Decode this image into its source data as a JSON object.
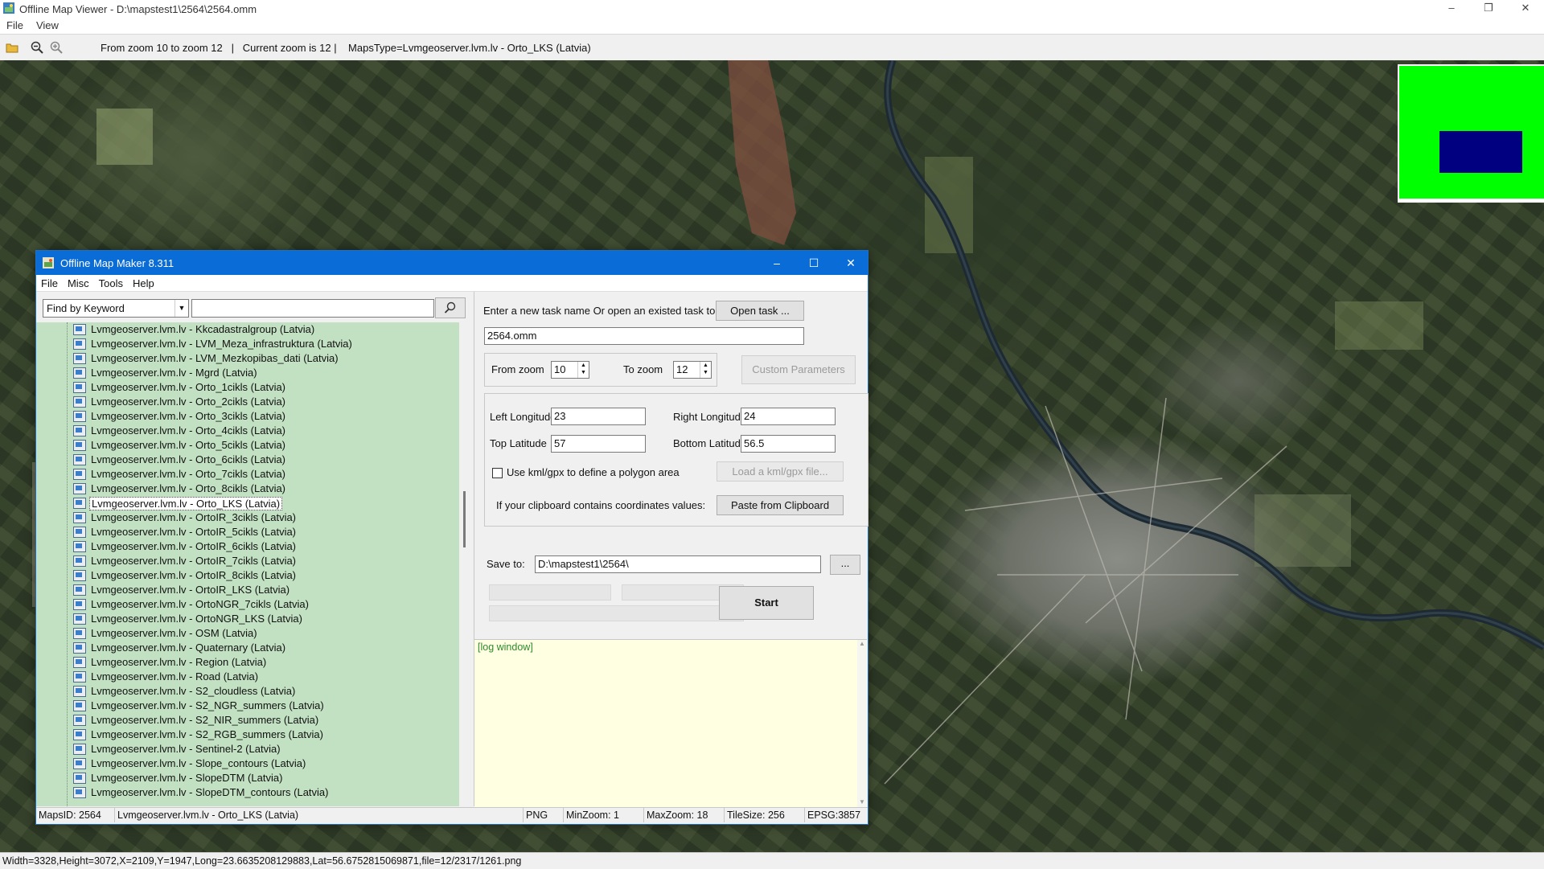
{
  "window": {
    "title": "Offline Map Viewer - D:\\mapstest1\\2564\\2564.omm",
    "buttons": {
      "minimize": "–",
      "maximize": "❐",
      "close": "✕"
    }
  },
  "menu": {
    "file": "File",
    "view": "View"
  },
  "toolbar": {
    "status": "From zoom 10 to zoom 12   |   Current zoom is 12 |    MapsType=Lvmgeoserver.lvm.lv - Orto_LKS (Latvia)"
  },
  "statusbar": {
    "text": "Width=3328,Height=3072,X=2109,Y=1947,Long=23.6635208129883,Lat=56.6752815069871,file=12/2317/1261.png"
  },
  "colors": {
    "overview_bg": "#00ff00",
    "overview_view": "#000080",
    "tree_bg": "#c2e0c2",
    "log_bg": "#ffffe1",
    "dialog_title": "#0a6cd6"
  },
  "dialog": {
    "title": "Offline Map Maker 8.311",
    "menu": {
      "file": "File",
      "misc": "Misc",
      "tools": "Tools",
      "help": "Help"
    },
    "find": {
      "mode": "Find by Keyword",
      "query": ""
    },
    "tree_items": [
      "Lvmgeoserver.lvm.lv - Kkcadastralgroup (Latvia)",
      "Lvmgeoserver.lvm.lv - LVM_Meza_infrastruktura (Latvia)",
      "Lvmgeoserver.lvm.lv - LVM_Mezkopibas_dati (Latvia)",
      "Lvmgeoserver.lvm.lv - Mgrd (Latvia)",
      "Lvmgeoserver.lvm.lv - Orto_1cikls (Latvia)",
      "Lvmgeoserver.lvm.lv - Orto_2cikls (Latvia)",
      "Lvmgeoserver.lvm.lv - Orto_3cikls (Latvia)",
      "Lvmgeoserver.lvm.lv - Orto_4cikls (Latvia)",
      "Lvmgeoserver.lvm.lv - Orto_5cikls (Latvia)",
      "Lvmgeoserver.lvm.lv - Orto_6cikls (Latvia)",
      "Lvmgeoserver.lvm.lv - Orto_7cikls (Latvia)",
      "Lvmgeoserver.lvm.lv - Orto_8cikls (Latvia)",
      "Lvmgeoserver.lvm.lv - Orto_LKS (Latvia)",
      "Lvmgeoserver.lvm.lv - OrtoIR_3cikls (Latvia)",
      "Lvmgeoserver.lvm.lv - OrtoIR_5cikls (Latvia)",
      "Lvmgeoserver.lvm.lv - OrtoIR_6cikls (Latvia)",
      "Lvmgeoserver.lvm.lv - OrtoIR_7cikls (Latvia)",
      "Lvmgeoserver.lvm.lv - OrtoIR_8cikls (Latvia)",
      "Lvmgeoserver.lvm.lv - OrtoIR_LKS (Latvia)",
      "Lvmgeoserver.lvm.lv - OrtoNGR_7cikls (Latvia)",
      "Lvmgeoserver.lvm.lv - OrtoNGR_LKS (Latvia)",
      "Lvmgeoserver.lvm.lv - OSM (Latvia)",
      "Lvmgeoserver.lvm.lv - Quaternary (Latvia)",
      "Lvmgeoserver.lvm.lv - Region (Latvia)",
      "Lvmgeoserver.lvm.lv - Road (Latvia)",
      "Lvmgeoserver.lvm.lv - S2_cloudless (Latvia)",
      "Lvmgeoserver.lvm.lv - S2_NGR_summers (Latvia)",
      "Lvmgeoserver.lvm.lv - S2_NIR_summers (Latvia)",
      "Lvmgeoserver.lvm.lv - S2_RGB_summers (Latvia)",
      "Lvmgeoserver.lvm.lv - Sentinel-2 (Latvia)",
      "Lvmgeoserver.lvm.lv - Slope_contours (Latvia)",
      "Lvmgeoserver.lvm.lv - SlopeDTM (Latvia)",
      "Lvmgeoserver.lvm.lv - SlopeDTM_contours (Latvia)"
    ],
    "selected_item": "Lvmgeoserver.lvm.lv - Orto_LKS (Latvia)",
    "task_prompt": "Enter a new task name Or open an existed task to continue:",
    "open_task_label": "Open task ...",
    "task_name": "2564.omm",
    "from_zoom_label": "From zoom",
    "from_zoom": "10",
    "to_zoom_label": "To zoom",
    "to_zoom": "12",
    "custom_params_label": "Custom Parameters",
    "left_long_label": "Left Longitude",
    "left_long": "23",
    "right_long_label": "Right Longitude",
    "right_long": "24",
    "top_lat_label": "Top Latitude",
    "top_lat": "57",
    "bottom_lat_label": "Bottom Latitude",
    "bottom_lat": "56.5",
    "kml_label": "Use kml/gpx to define a polygon area",
    "load_kml_label": "Load a kml/gpx file...",
    "clipboard_label": "If your clipboard contains coordinates values:",
    "paste_label": "Paste from Clipboard",
    "save_to_label": "Save to:",
    "save_path": "D:\\mapstest1\\2564\\",
    "browse_label": "...",
    "start_label": "Start",
    "log_text": "[log window]",
    "status": {
      "maps_id": "MapsID: 2564",
      "maps_name": "Lvmgeoserver.lvm.lv - Orto_LKS (Latvia)",
      "format": "PNG",
      "min_zoom": "MinZoom: 1",
      "max_zoom": "MaxZoom: 18",
      "tile_size": "TileSize: 256",
      "epsg": "EPSG:3857"
    }
  }
}
